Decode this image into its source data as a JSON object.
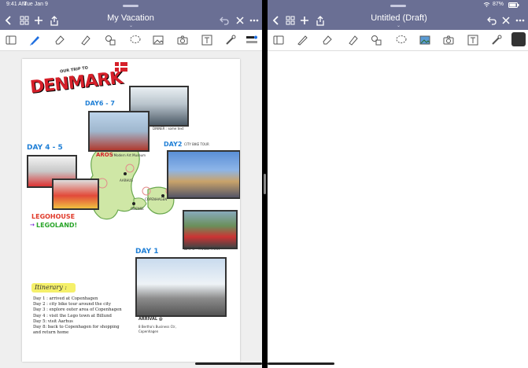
{
  "status": {
    "time": "9:41 AM",
    "date": "Tue Jan 9",
    "battery": "87%"
  },
  "left": {
    "title": "My Vacation",
    "note": {
      "heading_small": "OUR TRIP TO",
      "heading_big": "DENMARK",
      "day67": "DAY6 - 7",
      "dinner": "DINNER : some text",
      "day45": "DAY 4 - 5",
      "aros": "AROS",
      "aros_caption": "/ Modern Art Museum",
      "day2": "DAY2",
      "bike": "CITY BIKE TOUR",
      "legohouse": "LEGOHOUSE",
      "legoland": "LEGOLAND!",
      "aarhus": "AARHUS",
      "copenhagen": "COPENHAGEN",
      "odense": "ODENSE",
      "day3": "DAY 3 - TIVOLI PARK",
      "day1": "DAY 1",
      "itinerary_title": "Itinerary :",
      "itinerary": [
        "Day 1 : arrived at Copenhagen",
        "Day 2 : city bike tour around the city",
        "Day 3 : explore outer area of Copenhagen",
        "Day 4 : visit the Lego town at Billund",
        "Day 5: visit Aarhus",
        "Day 8: back to Copenhagen for shopping",
        "and return home"
      ],
      "arrival": "ARRIVAL @",
      "arrival_sub": "8 Bertha's Business Ctr, Copenhagen"
    }
  },
  "right": {
    "title": "Untitled (Draft)"
  },
  "colors": {
    "bar": "#6a6f94",
    "pen": "#1f6fe0",
    "accent_red": "#d6202a",
    "legohouse": "#e03a2a",
    "legoland": "#2aa52a",
    "day_blue": "#1f7fd6"
  }
}
